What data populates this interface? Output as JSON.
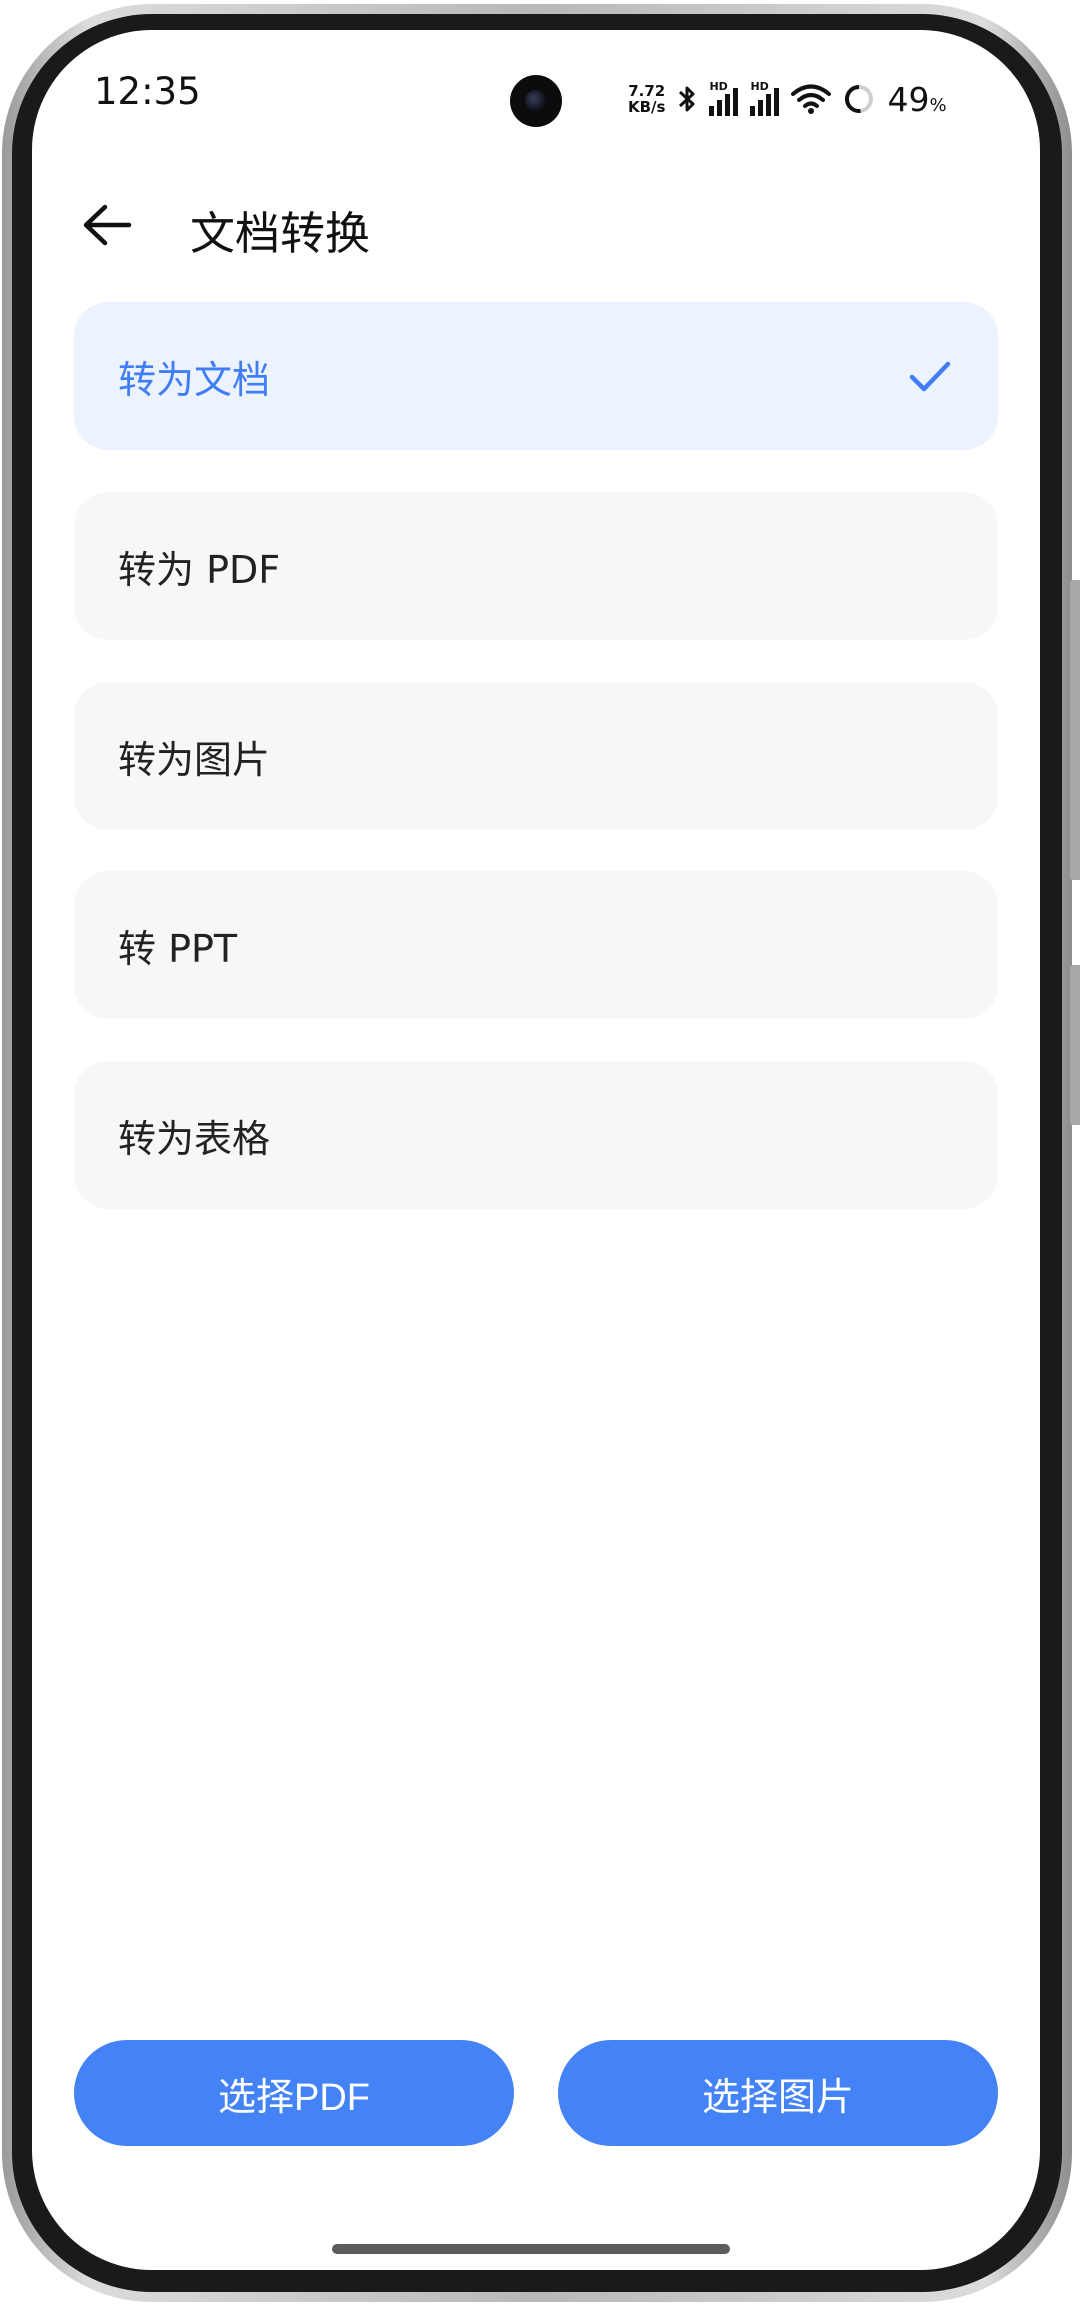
{
  "status_bar": {
    "time": "12:35",
    "net_speed_value": "7.72",
    "net_speed_unit": "KB/s",
    "hd_label_1": "HD",
    "hd_label_2": "HD",
    "battery_value": "49",
    "battery_unit": "%"
  },
  "header": {
    "title": "文档转换",
    "back_icon": "arrow-left-icon"
  },
  "options": [
    {
      "label": "转为文档",
      "selected": true
    },
    {
      "label": "转为 PDF",
      "selected": false
    },
    {
      "label": "转为图片",
      "selected": false
    },
    {
      "label": "转 PPT",
      "selected": false
    },
    {
      "label": "转为表格",
      "selected": false
    }
  ],
  "actions": {
    "select_pdf": "选择PDF",
    "select_image": "选择图片"
  },
  "colors": {
    "accent": "#4483f5",
    "selected_bg": "#ecf2fe",
    "option_bg": "#f7f7f7"
  }
}
